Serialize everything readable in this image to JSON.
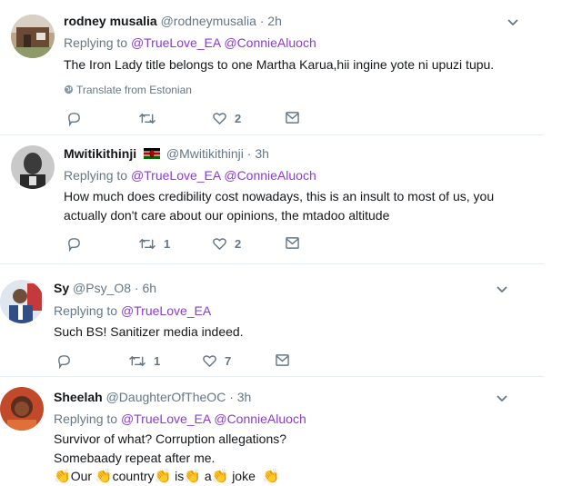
{
  "tweets": [
    {
      "name": "rodney musalia",
      "handle": "@rodneymusalia",
      "time": "· 2h",
      "replying_prefix": "Replying to",
      "mentions": [
        "@TrueLove_EA",
        "@ConnieAluoch"
      ],
      "text_lines": [
        "The Iron Lady title belongs to one Martha Karua,hii ingine yote ni upuzi tupu."
      ],
      "translate": "Translate from Estonian",
      "retweets": "",
      "likes": "2"
    },
    {
      "name": "Mwitikithinji",
      "handle": "@Mwitikithinji",
      "time": "· 3h",
      "replying_prefix": "Replying to",
      "mentions": [
        "@TrueLove_EA",
        "@ConnieAluoch"
      ],
      "text_lines": [
        "How much does credibility cost nowadays, this is an insult to most of us,  you",
        "actually don't care about our opinions, the mtadoo altitude"
      ],
      "retweets": "1",
      "likes": "2"
    },
    {
      "name": "Sy",
      "handle": "@Psy_O8",
      "time": "· 6h",
      "replying_prefix": "Replying to",
      "mentions": [
        "@TrueLove_EA"
      ],
      "text_lines": [
        "Such BS! Sanitizer media indeed."
      ],
      "retweets": "1",
      "likes": "7"
    },
    {
      "name": "Sheelah",
      "handle": "@DaughterOfTheOC",
      "time": "· 3h",
      "replying_prefix": "Replying to",
      "mentions": [
        "@TrueLove_EA",
        "@ConnieAluoch"
      ],
      "text_lines": [
        "Survivor of what? Corruption allegations?",
        "Somebaady repeat after me."
      ],
      "clap_words": [
        "Our",
        "country",
        "is",
        "a",
        "joke"
      ],
      "clap_glyph": "👏"
    }
  ]
}
